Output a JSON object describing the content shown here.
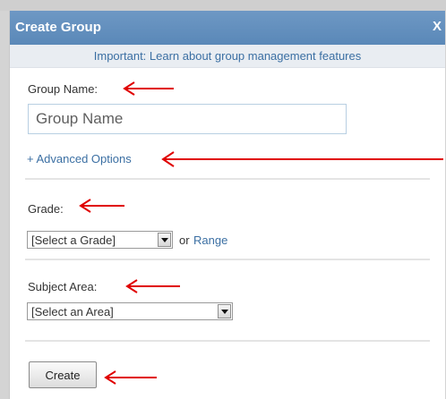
{
  "dialog": {
    "title": "Create Group",
    "close_label": "X",
    "notice_link": "Important: Learn about group management features"
  },
  "group_name": {
    "label": "Group Name:",
    "placeholder": "Group Name",
    "value": ""
  },
  "advanced_options": {
    "label": "+ Advanced Options"
  },
  "grade": {
    "label": "Grade:",
    "selected": "[Select a Grade]",
    "or_text": "or",
    "range_link": "Range"
  },
  "subject_area": {
    "label": "Subject Area:",
    "selected": "[Select an Area]"
  },
  "actions": {
    "create_label": "Create"
  },
  "colors": {
    "titlebar": "#5a88b8",
    "link": "#3b6fa3",
    "annotation_arrow": "#e00000"
  },
  "icons": {
    "dropdown": "chevron-down-icon",
    "annotation": "arrow-left-icon"
  }
}
